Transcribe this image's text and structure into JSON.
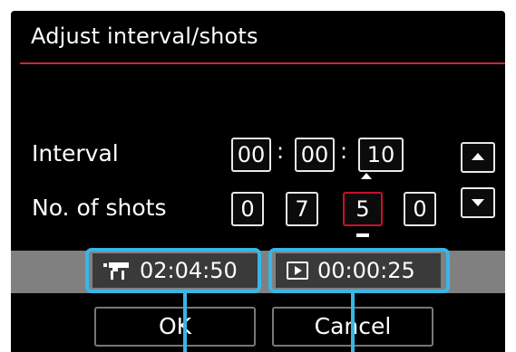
{
  "dialog": {
    "title": "Adjust interval/shots"
  },
  "interval": {
    "label": "Interval",
    "hours": "00",
    "minutes": "00",
    "seconds": "10",
    "separator": ":"
  },
  "shots": {
    "label": "No. of shots",
    "digits": [
      "0",
      "7",
      "5",
      "0"
    ],
    "selected_digit_index": 2
  },
  "info": {
    "movie_duration": "02:04:50",
    "playback_duration": "00:00:25",
    "movie_icon": "movie-camera-icon",
    "playback_icon": "playback-icon"
  },
  "buttons": {
    "ok": "OK",
    "cancel": "Cancel"
  },
  "colors": {
    "screen_bg": "#000000",
    "title_line": "#c42a3a",
    "selected_border": "#c8102e",
    "callout": "#38b6e6",
    "info_bar": "#808080"
  }
}
